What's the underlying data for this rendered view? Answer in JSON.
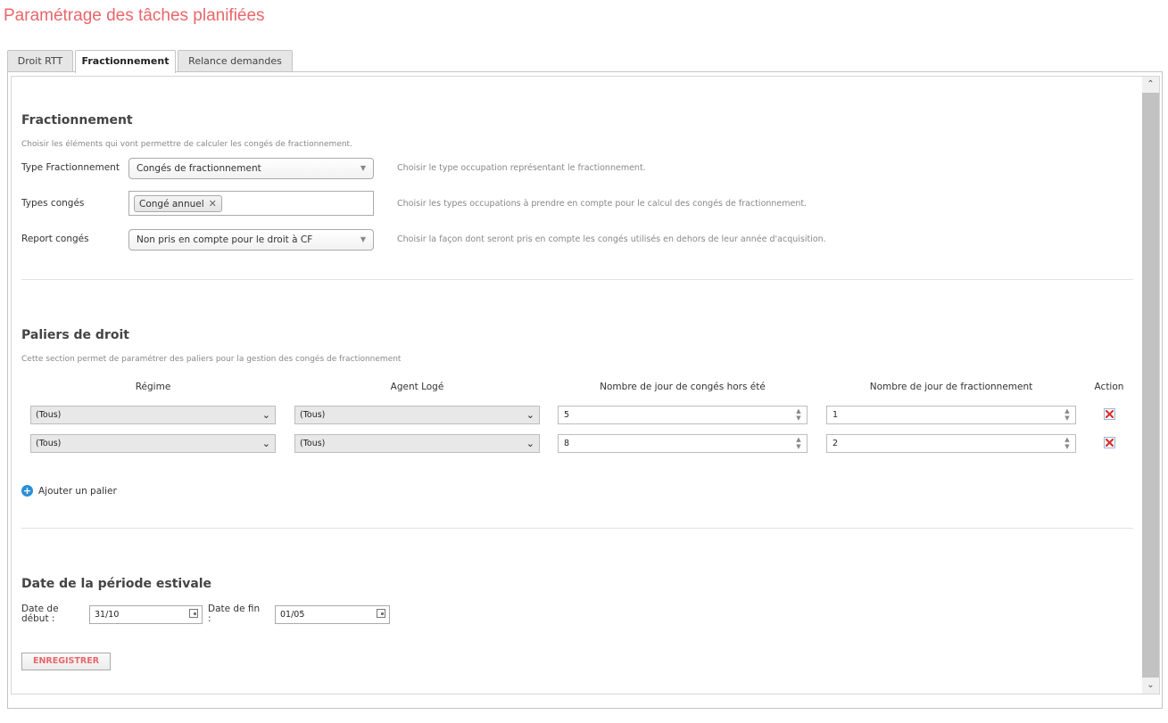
{
  "page": {
    "title": "Paramétrage des tâches planifiées"
  },
  "tabs": [
    {
      "label": "Droit RTT",
      "active": false
    },
    {
      "label": "Fractionnement",
      "active": true
    },
    {
      "label": "Relance demandes",
      "active": false
    }
  ],
  "fractionnement": {
    "title": "Fractionnement",
    "description": "Choisir les éléments qui vont permettre de calculer les congés de fractionnement.",
    "type_label": "Type Fractionnement",
    "type_value": "Congés de fractionnement",
    "type_hint": "Choisir le type occupation représentant le fractionnement.",
    "types_label": "Types congés",
    "types_tags": [
      "Congé annuel"
    ],
    "types_hint": "Choisir les types occupations à prendre en compte pour le calcul des congés de fractionnement.",
    "report_label": "Report congés",
    "report_value": "Non pris en compte pour le droit à CF",
    "report_hint": "Choisir la façon dont seront pris en compte les congés utilisés en dehors de leur année d'acquisition."
  },
  "paliers": {
    "title": "Paliers de droit",
    "description": "Cette section permet de paramétrer des paliers pour la gestion des congés de fractionnement",
    "columns": [
      "Régime",
      "Agent Logé",
      "Nombre de jour de congés hors été",
      "Nombre de jour de fractionnement",
      "Action"
    ],
    "rows": [
      {
        "regime": "(Tous)",
        "agent_loge": "(Tous)",
        "jours_hors_ete": "5",
        "jours_fractionnement": "1"
      },
      {
        "regime": "(Tous)",
        "agent_loge": "(Tous)",
        "jours_hors_ete": "8",
        "jours_fractionnement": "2"
      }
    ],
    "add_label": "Ajouter un palier"
  },
  "periode": {
    "title": "Date de la période estivale",
    "start_label_line1": "Date de",
    "start_label_line2": "début :",
    "start_value": "31/10",
    "end_label_line1": "Date de fin",
    "end_label_line2": ":",
    "end_value": "01/05"
  },
  "actions": {
    "save_label": "ENREGISTRER"
  },
  "icons": {
    "add": "plus-circle-icon",
    "delete": "red-x-icon",
    "calendar": "calendar-icon",
    "remove_tag": "close-icon"
  },
  "colors": {
    "accent": "#e9666a",
    "add_icon": "#2b8fd6",
    "delete_icon": "#d9302c"
  }
}
